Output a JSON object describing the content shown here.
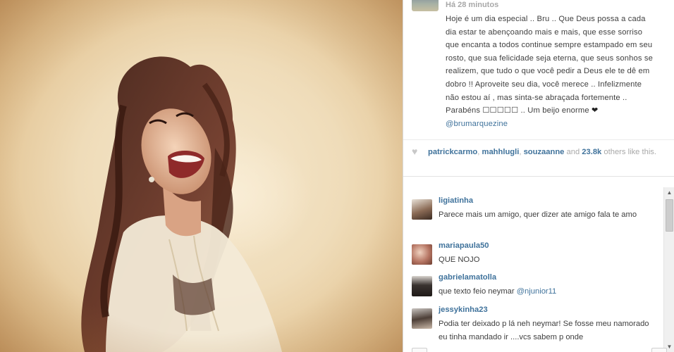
{
  "post": {
    "timestamp": "Há 28 minutos",
    "caption_text": "Hoje é um dia especial .. Bru .. Que Deus possa a cada dia estar te abençoando mais e mais, que esse sorriso que encanta a todos continue sempre estampado em seu rosto, que sua felicidade seja eterna, que seus sonhos se realizem, que tudo o que você pedir a Deus ele te dê em dobro !! Aproveite seu dia, você merece .. Infelizmente não estou aí , mas sinta-se abraçada fortemente .. Parabéns ☐☐☐☐☐ .. Um beijo enorme",
    "caption_heart": "❤",
    "caption_mention": "@brumarquezine"
  },
  "likes": {
    "users": [
      "patrickcarmo",
      "mahhlugli",
      "souzaanne"
    ],
    "separator": ",",
    "and_text": "and",
    "count": "23.8k",
    "others_text": "others like this."
  },
  "comments": [
    {
      "user": "ligiatinha",
      "text": "Parece mais um amigo, quer dizer ate amigo fala te amo",
      "mention": ""
    },
    {
      "user": "mariapaula50",
      "text": "QUE NOJO",
      "mention": ""
    },
    {
      "user": "gabrielamatolla",
      "text": "que texto feio neymar",
      "mention": "@njunior11"
    },
    {
      "user": "jessykinha23",
      "text": "Podia ter deixado p lá neh neymar! Se fosse meu namorado eu tinha mandado ir ....vcs sabem p onde",
      "mention": ""
    }
  ],
  "icons": {
    "likes": "heart-icon",
    "scroll_up": "scroll-up-arrow-icon",
    "scroll_down": "scroll-down-arrow-icon"
  },
  "colors": {
    "link_blue": "#3f729b",
    "muted_gray": "#a8a8a8",
    "text": "#3f3f3f"
  }
}
